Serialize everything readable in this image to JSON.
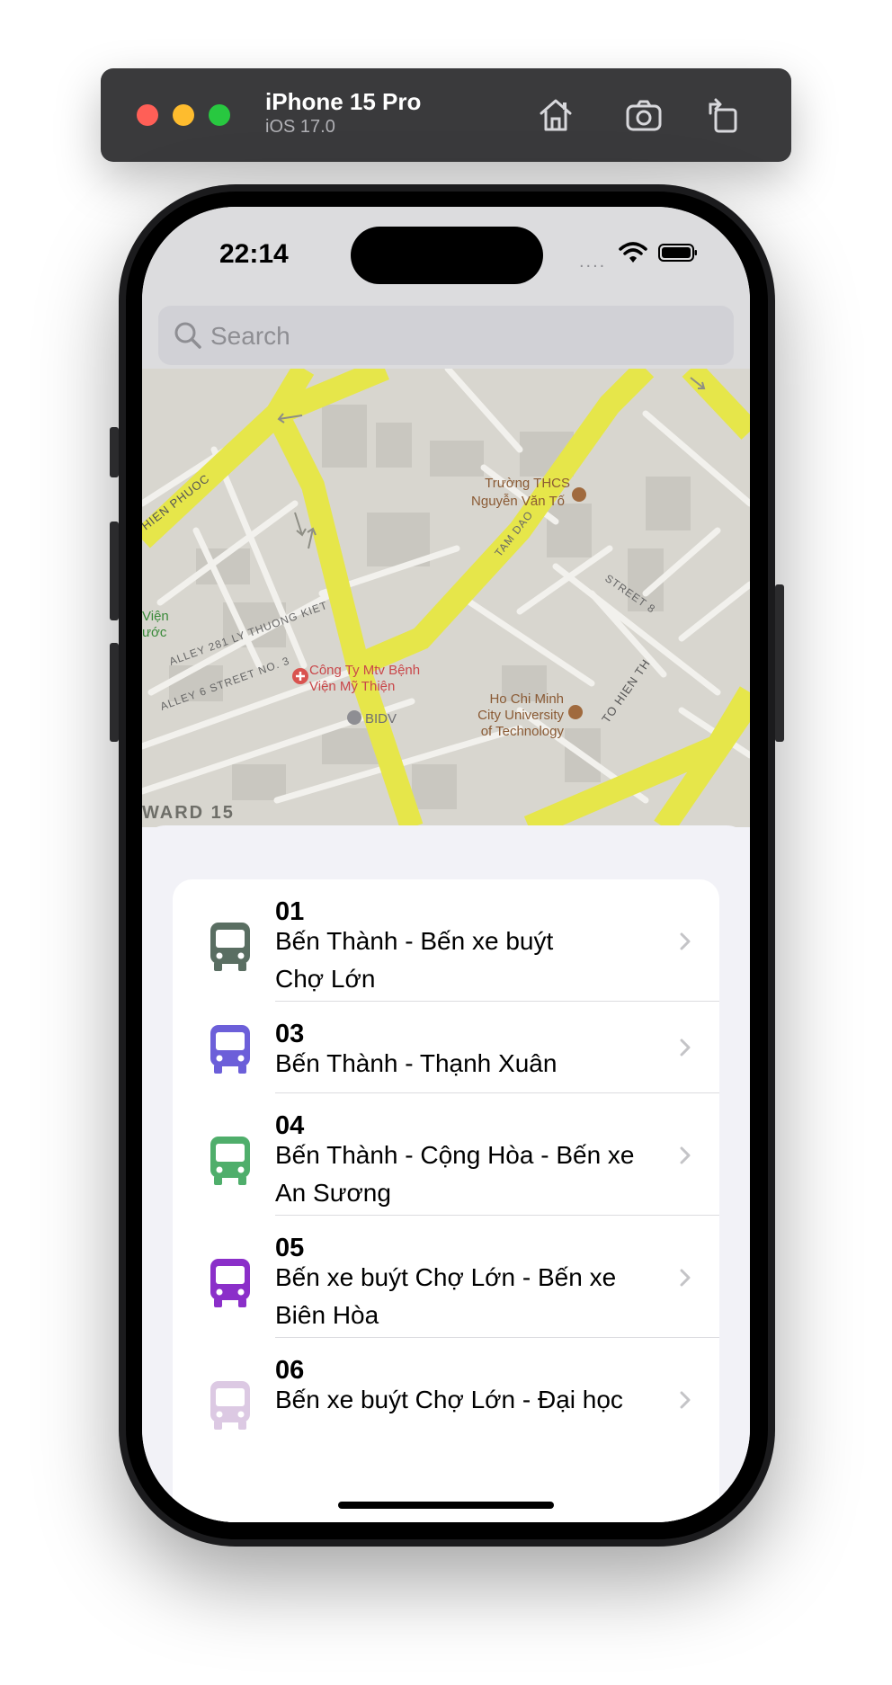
{
  "simulator": {
    "device_name": "iPhone 15 Pro",
    "os_version": "iOS 17.0",
    "buttons": [
      "home-icon",
      "screenshot-icon",
      "rotate-icon"
    ]
  },
  "status_bar": {
    "time": "22:14",
    "signal": "....",
    "icons": [
      "wifi-icon",
      "battery-icon"
    ]
  },
  "search": {
    "placeholder": "Search",
    "value": ""
  },
  "map": {
    "labels": {
      "school": "Trường THCS",
      "school2": "Nguyễn Văn Tố",
      "company": "Công Ty Mtv Bệnh",
      "company2": "Viện Mỹ Thiện",
      "bank": "BIDV",
      "university": "Ho Chi Minh",
      "university2": "City University",
      "university3": "of Technology",
      "street_hien_phuoc": "HIEN PHUOC",
      "street_tam_dao": "TAM DAO",
      "street_alley281": "ALLEY 281 LY THUONG KIET",
      "street_alley6": "ALLEY 6 STREET NO. 3",
      "street_right": "STREET 8",
      "street_to_hien": "TO HIEN TH",
      "ward": "WARD 15",
      "vien1": "Viện",
      "vien2": "ước"
    },
    "colors": {
      "road": "#e6e64a",
      "land": "#d8d6cf",
      "street": "#f2f1ed",
      "block": "#c9c7c0"
    }
  },
  "routes": [
    {
      "number": "01",
      "line1": "Bến Thành - Bến xe buýt",
      "line2": "Chợ Lớn",
      "color": "#5a6e62"
    },
    {
      "number": "03",
      "line1": "Bến Thành - Thạnh Xuân",
      "line2": "",
      "color": "#6c5fd9"
    },
    {
      "number": "04",
      "line1": "Bến Thành - Cộng Hòa - Bến xe",
      "line2": "An Sương",
      "color": "#4fae6b"
    },
    {
      "number": "05",
      "line1": "Bến xe buýt Chợ Lớn - Bến xe",
      "line2": "Biên Hòa",
      "color": "#8b2fc9"
    },
    {
      "number": "06",
      "line1": "Bến xe buýt Chợ Lớn - Đại học",
      "line2": "",
      "color": "#dcc9e3"
    }
  ]
}
